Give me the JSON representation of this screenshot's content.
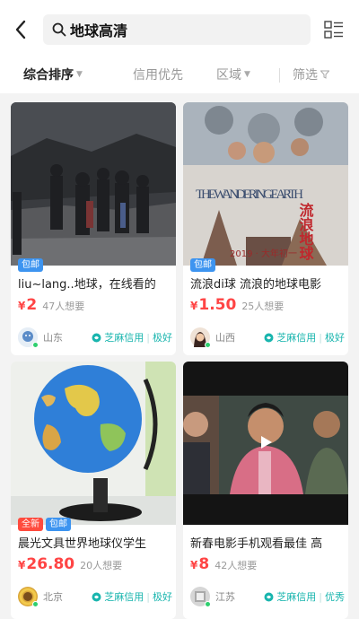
{
  "search": {
    "query": "地球高清"
  },
  "icons": {
    "back": "back-arrow-icon",
    "search": "search-icon",
    "layout": "list-grid-icon",
    "credit": "zhima-credit-icon",
    "play": "play-icon"
  },
  "filters": [
    {
      "label": "综合排序",
      "active": true
    },
    {
      "label": "信用优先",
      "active": false
    },
    {
      "label": "区域",
      "active": false
    },
    {
      "label": "筛选",
      "active": false
    }
  ],
  "colors": {
    "price": "#ff4444",
    "credit": "#19b5ae",
    "tag_blue": "#3d94f0",
    "tag_red": "#ff4b3e"
  },
  "products": [
    {
      "title": "liu~lang..地球，在线看的",
      "currency": "¥",
      "price": "2",
      "want": "47人想要",
      "tags": [
        "包邮"
      ],
      "location": "山东",
      "credit_label": "芝麻信用",
      "credit_level": "极好"
    },
    {
      "title": "流浪di球 流浪的地球电影",
      "currency": "¥",
      "price": "1.50",
      "want": "25人想要",
      "tags": [
        "包邮"
      ],
      "location": "山西",
      "credit_label": "芝麻信用",
      "credit_level": "极好",
      "poster_title": "THE WANDERING EARTH",
      "poster_cn": "流浪地球",
      "poster_date": "2019 · 大年初一"
    },
    {
      "title": "晨光文具世界地球仪学生",
      "currency": "¥",
      "price": "26.80",
      "want": "20人想要",
      "tags": [
        "全新",
        "包邮"
      ],
      "location": "北京",
      "credit_label": "芝麻信用",
      "credit_level": "极好"
    },
    {
      "title": "新春电影手机观看最佳 高",
      "currency": "¥",
      "price": "8",
      "want": "42人想要",
      "tags": [],
      "location": "江苏",
      "credit_label": "芝麻信用",
      "credit_level": "优秀"
    }
  ]
}
